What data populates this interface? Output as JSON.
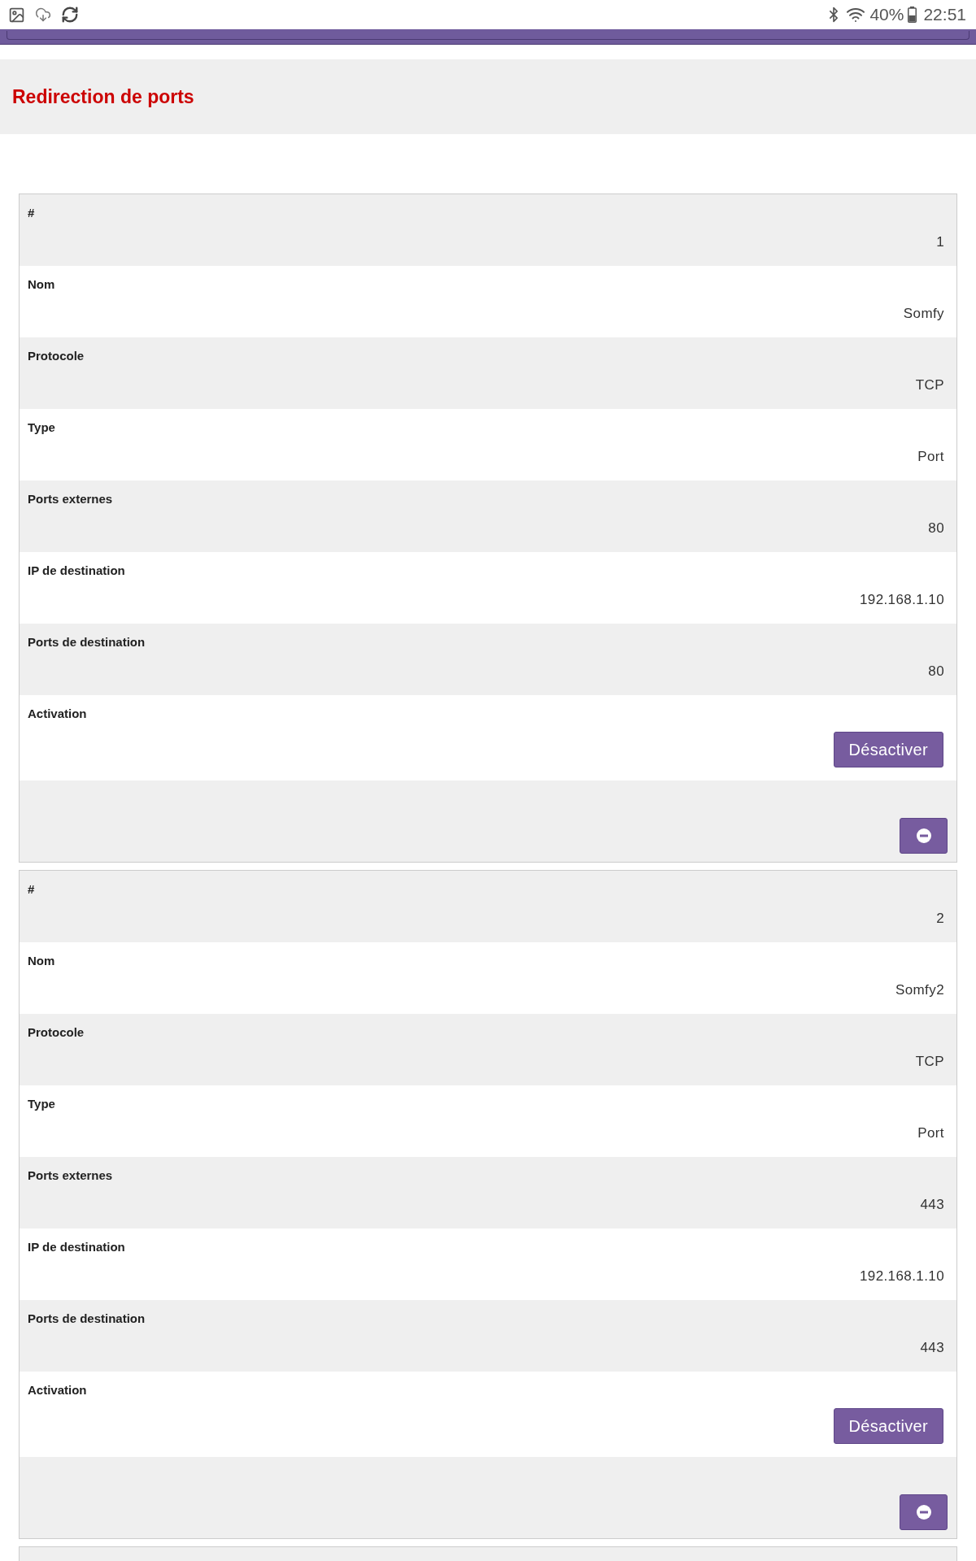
{
  "status_bar": {
    "battery": "40%",
    "time": "22:51"
  },
  "page": {
    "title": "Redirection de ports"
  },
  "rules": [
    {
      "fields": [
        {
          "kind": "text",
          "label": "#",
          "value": "1"
        },
        {
          "kind": "text",
          "label": "Nom",
          "value": "Somfy"
        },
        {
          "kind": "text",
          "label": "Protocole",
          "value": "TCP"
        },
        {
          "kind": "text",
          "label": "Type",
          "value": "Port"
        },
        {
          "kind": "text",
          "label": "Ports externes",
          "value": "80"
        },
        {
          "kind": "text",
          "label": "IP de destination",
          "value": "192.168.1.10"
        },
        {
          "kind": "text",
          "label": "Ports de destination",
          "value": "80"
        },
        {
          "kind": "button",
          "label": "Activation",
          "value": "Désactiver"
        }
      ]
    },
    {
      "fields": [
        {
          "kind": "text",
          "label": "#",
          "value": "2"
        },
        {
          "kind": "text",
          "label": "Nom",
          "value": "Somfy2"
        },
        {
          "kind": "text",
          "label": "Protocole",
          "value": "TCP"
        },
        {
          "kind": "text",
          "label": "Type",
          "value": "Port"
        },
        {
          "kind": "text",
          "label": "Ports externes",
          "value": "443"
        },
        {
          "kind": "text",
          "label": "IP de destination",
          "value": "192.168.1.10"
        },
        {
          "kind": "text",
          "label": "Ports de destination",
          "value": "443"
        },
        {
          "kind": "button",
          "label": "Activation",
          "value": "Désactiver"
        }
      ]
    }
  ]
}
